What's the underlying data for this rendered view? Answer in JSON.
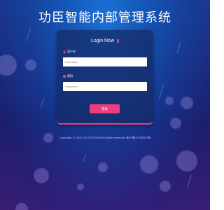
{
  "header": {
    "title": "功臣智能内部管理系统"
  },
  "login_card": {
    "title": "Login Now",
    "lock_icon": "lock-icon",
    "username": {
      "label": "用户名",
      "icon": "user-icon",
      "placeholder": "Username",
      "value": ""
    },
    "password": {
      "label": "密码",
      "icon": "lock-icon",
      "placeholder": "Password",
      "value": ""
    },
    "submit_label": "登录"
  },
  "footer": {
    "copyright": "Copyright © 2017-2023 GCTECH All rights reserved. 粤ICP备17106373号"
  },
  "colors": {
    "accent": "#ec3d7f",
    "background_top": "#1f6fd6",
    "background_bottom": "#2a1a66",
    "card_background": "#162a64"
  }
}
